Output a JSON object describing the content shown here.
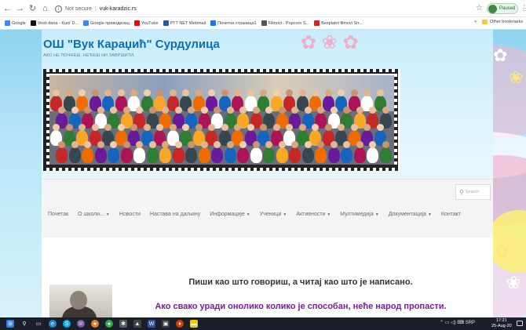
{
  "browser": {
    "url_status": "Not secure",
    "url": "vuk-karadzic.rs",
    "profile_status": "Paused",
    "bookmarks": [
      {
        "label": "Google",
        "color": "#4285f4"
      },
      {
        "label": "Vesti dana - Kurir D...",
        "color": "#111111"
      },
      {
        "label": "Google преводилац",
        "color": "#4285f4"
      },
      {
        "label": "YouTube",
        "color": "#ff0000"
      },
      {
        "label": "PTT NET Webmail",
        "color": "#2b579a"
      },
      {
        "label": "Почетна страница1",
        "color": "#1877f2"
      },
      {
        "label": "Filmovi - Popcorn S...",
        "color": "#555555"
      },
      {
        "label": "Besplatni filmovi Str...",
        "color": "#c62828"
      }
    ],
    "other_bookmarks": "Other bookmarks"
  },
  "site": {
    "title": "ОШ \"Вук Караџић\" Сурдулица",
    "tagline": "АКО НЕ ПОЧНЕШ, НЕЋЕШ НИ ЗАВРШИТИ.",
    "search_placeholder": "Search",
    "menu": [
      {
        "label": "Почетак",
        "has_dropdown": false
      },
      {
        "label": "О школи...",
        "has_dropdown": true
      },
      {
        "label": "Новости",
        "has_dropdown": false
      },
      {
        "label": "Настава на даљину",
        "has_dropdown": false
      },
      {
        "label": "Информације",
        "has_dropdown": true
      },
      {
        "label": "Ученици",
        "has_dropdown": true
      },
      {
        "label": "Активности",
        "has_dropdown": true
      },
      {
        "label": "Мултимедија",
        "has_dropdown": true
      },
      {
        "label": "Документација",
        "has_dropdown": true
      },
      {
        "label": "Контакт",
        "has_dropdown": false
      }
    ],
    "quote_primary": "Пиши као што говориш, а читај као што је написано.",
    "quote_secondary": "Ако свако уради онолико колико је способан, неће народ пропасти."
  },
  "taskbar": {
    "tray_lang": "SRP",
    "time": "17:21",
    "date": "25-Aug-20"
  }
}
